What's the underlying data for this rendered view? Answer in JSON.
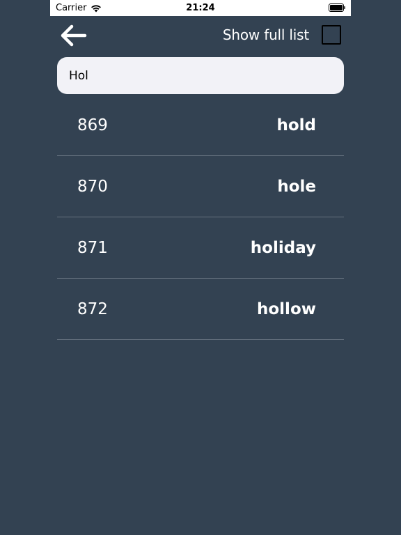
{
  "status_bar": {
    "carrier": "Carrier",
    "time": "21:24",
    "wifi_icon": "wifi-icon",
    "battery_icon": "battery-icon"
  },
  "header": {
    "back_icon": "arrow-left-icon",
    "show_full_label": "Show full list",
    "show_full_checked": false
  },
  "search": {
    "value": "Hol",
    "placeholder": ""
  },
  "results": [
    {
      "number": "869",
      "word": "hold"
    },
    {
      "number": "870",
      "word": "hole"
    },
    {
      "number": "871",
      "word": "holiday"
    },
    {
      "number": "872",
      "word": "hollow"
    }
  ],
  "colors": {
    "background": "#334252",
    "search_background": "#f2f2f7",
    "separator": "#66727f",
    "text": "#ffffff"
  }
}
